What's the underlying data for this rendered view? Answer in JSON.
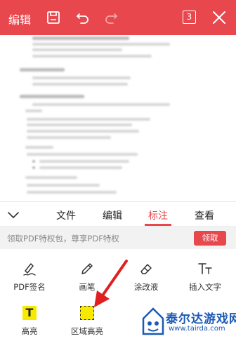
{
  "header": {
    "title": "编辑",
    "page_count": "3",
    "icons": [
      "save-icon",
      "undo-icon",
      "redo-icon",
      "page-count-icon",
      "close-icon"
    ],
    "bg_color": "#e8474e"
  },
  "tabs": {
    "items": [
      {
        "label": "文件",
        "active": false
      },
      {
        "label": "编辑",
        "active": false
      },
      {
        "label": "标注",
        "active": true
      },
      {
        "label": "查看",
        "active": false
      }
    ],
    "active_color": "#e8474e"
  },
  "promo": {
    "text": "领取PDF特权包，尊享PDF特权",
    "button_label": "领取"
  },
  "tools": [
    {
      "label": "PDF签名",
      "icon": "signature-icon"
    },
    {
      "label": "画笔",
      "icon": "pen-icon"
    },
    {
      "label": "涂改液",
      "icon": "eraser-icon"
    },
    {
      "label": "插入文字",
      "icon": "insert-text-icon"
    },
    {
      "label": "高亮",
      "icon": "highlight-icon"
    },
    {
      "label": "区域高亮",
      "icon": "area-highlight-icon"
    }
  ],
  "watermark": {
    "brand": "泰尔达游戏网",
    "url": "www.tairda.com"
  }
}
